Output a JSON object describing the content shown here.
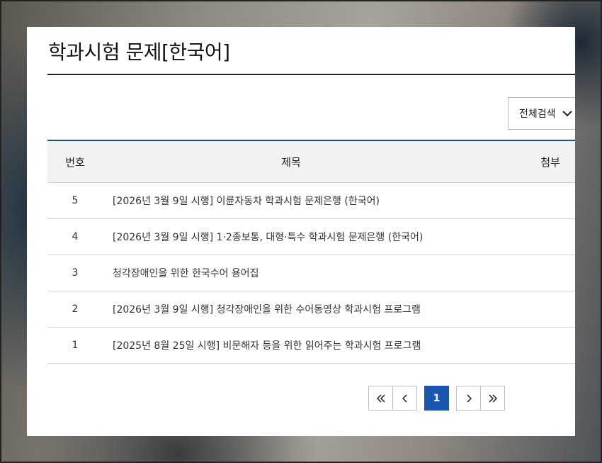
{
  "page": {
    "title": "학과시험 문제[한국어]"
  },
  "search": {
    "scope_label": "전체검색"
  },
  "table": {
    "headers": {
      "no": "번호",
      "title": "제목",
      "attachment": "첨부"
    },
    "rows": [
      {
        "no": "5",
        "title": "[2026년 3월 9일 시행] 이륜자동차 학과시험 문제은행 (한국어)"
      },
      {
        "no": "4",
        "title": "[2026년 3월 9일 시행] 1·2종보통, 대형·특수 학과시험 문제은행 (한국어)"
      },
      {
        "no": "3",
        "title": "청각장애인을 위한 한국수어 용어집"
      },
      {
        "no": "2",
        "title": "[2026년 3월 9일 시행] 청각장애인을 위한 수어동영상 학과시험 프로그램"
      },
      {
        "no": "1",
        "title": "[2025년 8월 25일 시행] 비문해자 등을 위한 읽어주는 학과시험 프로그램"
      }
    ]
  },
  "pagination": {
    "current_page": "1",
    "icons": [
      "double-chevron-left-icon",
      "chevron-left-icon",
      "chevron-right-icon",
      "double-chevron-right-icon"
    ]
  },
  "colors": {
    "accent": "#1a56b0",
    "header_rule": "#1f4e8c",
    "header_bg": "#f2f2f2"
  }
}
